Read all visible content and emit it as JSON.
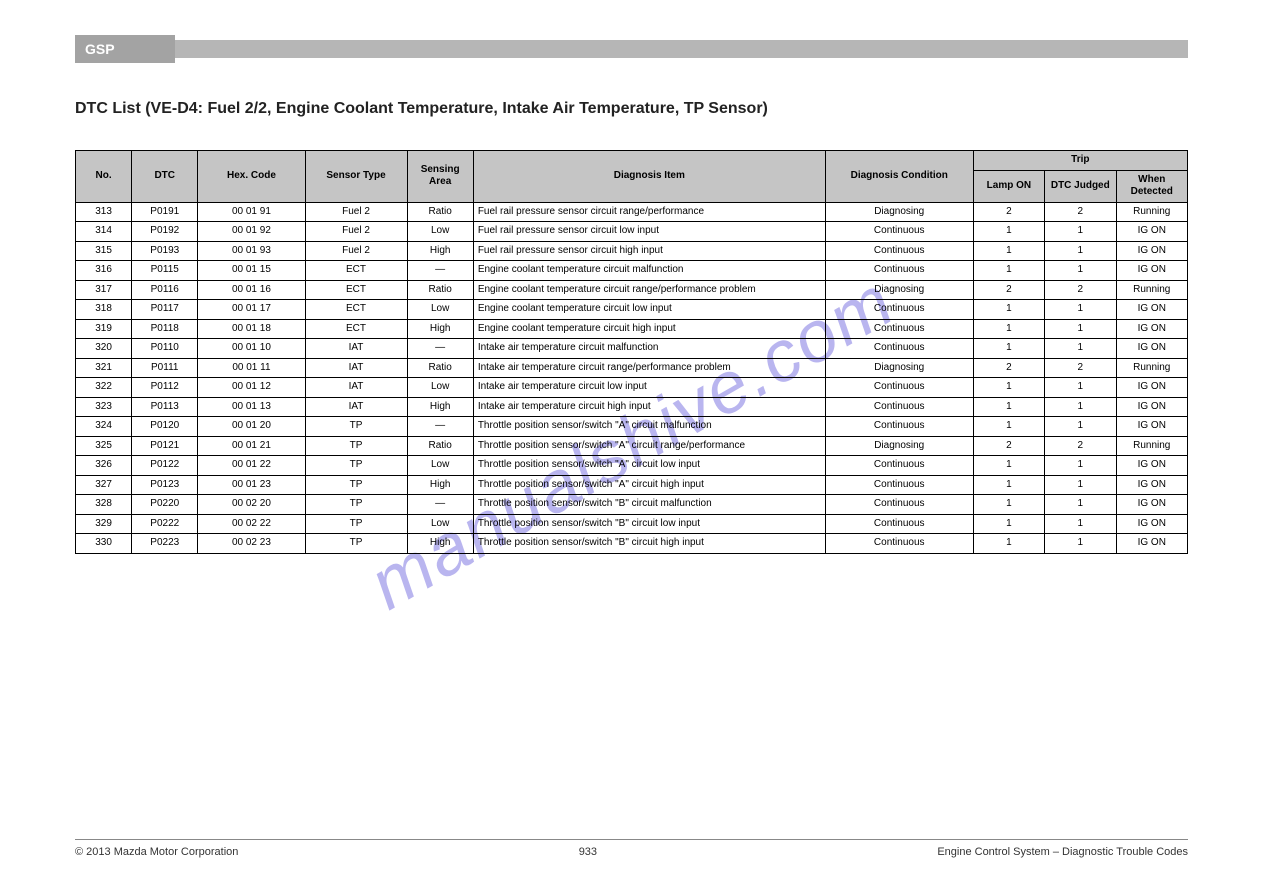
{
  "header": {
    "tab_label": "GSP",
    "page_num": "933"
  },
  "section_title": "DTC List (VE-D4: Fuel 2/2, Engine Coolant Temperature, Intake Air Temperature, TP Sensor)",
  "watermark": "manualshive.com",
  "columns": {
    "num": "No.",
    "dtc": "DTC",
    "hex": "Hex. Code",
    "type": "Sensor Type",
    "sensing": "Sensing Area",
    "item": "Diagnosis Item",
    "condition": "Diagnosis Condition",
    "trip_group": "Trip",
    "trip1": "Lamp ON",
    "trip2": "DTC Judged",
    "trip3": "When Detected"
  },
  "rows": [
    {
      "num": "313",
      "dtc": "P0191",
      "hex": "00 01 91",
      "type": "Fuel 2",
      "sensing": "Ratio",
      "item": "Fuel rail pressure sensor circuit range/performance",
      "cond": "Diagnosing",
      "t1": "2",
      "t2": "2",
      "t3": "Running"
    },
    {
      "num": "314",
      "dtc": "P0192",
      "hex": "00 01 92",
      "type": "Fuel 2",
      "sensing": "Low",
      "item": "Fuel rail pressure sensor circuit low input",
      "cond": "Continuous",
      "t1": "1",
      "t2": "1",
      "t3": "IG ON"
    },
    {
      "num": "315",
      "dtc": "P0193",
      "hex": "00 01 93",
      "type": "Fuel 2",
      "sensing": "High",
      "item": "Fuel rail pressure sensor circuit high input",
      "cond": "Continuous",
      "t1": "1",
      "t2": "1",
      "t3": "IG ON"
    },
    {
      "num": "316",
      "dtc": "P0115",
      "hex": "00 01 15",
      "type": "ECT",
      "sensing": "—",
      "item": "Engine coolant temperature circuit malfunction",
      "cond": "Continuous",
      "t1": "1",
      "t2": "1",
      "t3": "IG ON"
    },
    {
      "num": "317",
      "dtc": "P0116",
      "hex": "00 01 16",
      "type": "ECT",
      "sensing": "Ratio",
      "item": "Engine coolant temperature circuit range/performance problem",
      "cond": "Diagnosing",
      "t1": "2",
      "t2": "2",
      "t3": "Running"
    },
    {
      "num": "318",
      "dtc": "P0117",
      "hex": "00 01 17",
      "type": "ECT",
      "sensing": "Low",
      "item": "Engine coolant temperature circuit low input",
      "cond": "Continuous",
      "t1": "1",
      "t2": "1",
      "t3": "IG ON"
    },
    {
      "num": "319",
      "dtc": "P0118",
      "hex": "00 01 18",
      "type": "ECT",
      "sensing": "High",
      "item": "Engine coolant temperature circuit high input",
      "cond": "Continuous",
      "t1": "1",
      "t2": "1",
      "t3": "IG ON"
    },
    {
      "num": "320",
      "dtc": "P0110",
      "hex": "00 01 10",
      "type": "IAT",
      "sensing": "—",
      "item": "Intake air temperature circuit malfunction",
      "cond": "Continuous",
      "t1": "1",
      "t2": "1",
      "t3": "IG ON"
    },
    {
      "num": "321",
      "dtc": "P0111",
      "hex": "00 01 11",
      "type": "IAT",
      "sensing": "Ratio",
      "item": "Intake air temperature circuit range/performance problem",
      "cond": "Diagnosing",
      "t1": "2",
      "t2": "2",
      "t3": "Running"
    },
    {
      "num": "322",
      "dtc": "P0112",
      "hex": "00 01 12",
      "type": "IAT",
      "sensing": "Low",
      "item": "Intake air temperature circuit low input",
      "cond": "Continuous",
      "t1": "1",
      "t2": "1",
      "t3": "IG ON"
    },
    {
      "num": "323",
      "dtc": "P0113",
      "hex": "00 01 13",
      "type": "IAT",
      "sensing": "High",
      "item": "Intake air temperature circuit high input",
      "cond": "Continuous",
      "t1": "1",
      "t2": "1",
      "t3": "IG ON"
    },
    {
      "num": "324",
      "dtc": "P0120",
      "hex": "00 01 20",
      "type": "TP",
      "sensing": "—",
      "item": "Throttle position sensor/switch \"A\" circuit malfunction",
      "cond": "Continuous",
      "t1": "1",
      "t2": "1",
      "t3": "IG ON"
    },
    {
      "num": "325",
      "dtc": "P0121",
      "hex": "00 01 21",
      "type": "TP",
      "sensing": "Ratio",
      "item": "Throttle position sensor/switch \"A\" circuit range/performance",
      "cond": "Diagnosing",
      "t1": "2",
      "t2": "2",
      "t3": "Running"
    },
    {
      "num": "326",
      "dtc": "P0122",
      "hex": "00 01 22",
      "type": "TP",
      "sensing": "Low",
      "item": "Throttle position sensor/switch \"A\" circuit low input",
      "cond": "Continuous",
      "t1": "1",
      "t2": "1",
      "t3": "IG ON"
    },
    {
      "num": "327",
      "dtc": "P0123",
      "hex": "00 01 23",
      "type": "TP",
      "sensing": "High",
      "item": "Throttle position sensor/switch \"A\" circuit high input",
      "cond": "Continuous",
      "t1": "1",
      "t2": "1",
      "t3": "IG ON"
    },
    {
      "num": "328",
      "dtc": "P0220",
      "hex": "00 02 20",
      "type": "TP",
      "sensing": "—",
      "item": "Throttle position sensor/switch \"B\" circuit malfunction",
      "cond": "Continuous",
      "t1": "1",
      "t2": "1",
      "t3": "IG ON"
    },
    {
      "num": "329",
      "dtc": "P0222",
      "hex": "00 02 22",
      "type": "TP",
      "sensing": "Low",
      "item": "Throttle position sensor/switch \"B\" circuit low input",
      "cond": "Continuous",
      "t1": "1",
      "t2": "1",
      "t3": "IG ON"
    },
    {
      "num": "330",
      "dtc": "P0223",
      "hex": "00 02 23",
      "type": "TP",
      "sensing": "High",
      "item": "Throttle position sensor/switch \"B\" circuit high input",
      "cond": "Continuous",
      "t1": "1",
      "t2": "1",
      "t3": "IG ON"
    }
  ],
  "footer": {
    "left": "© 2013 Mazda Motor Corporation",
    "right": "Engine Control System – Diagnostic Trouble Codes"
  }
}
